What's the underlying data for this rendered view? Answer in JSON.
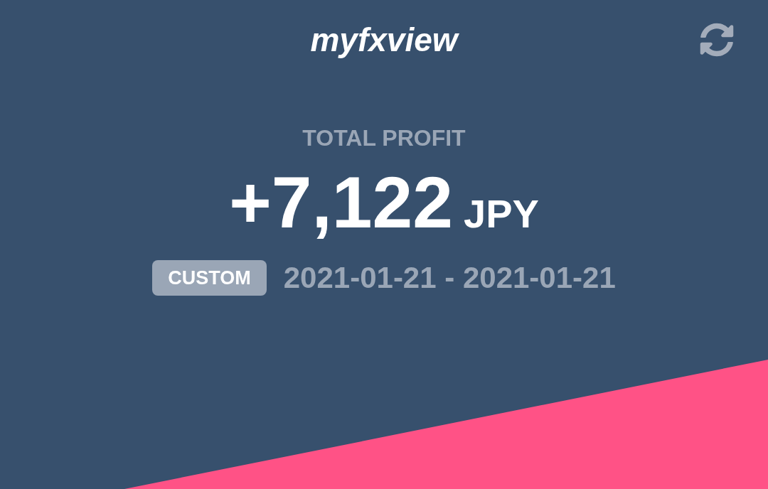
{
  "header": {
    "title": "myfxview"
  },
  "summary": {
    "label": "TOTAL PROFIT",
    "amount": "+7,122",
    "currency": "JPY",
    "range_badge": "CUSTOM",
    "date_range": "2021-01-21 - 2021-01-21"
  }
}
